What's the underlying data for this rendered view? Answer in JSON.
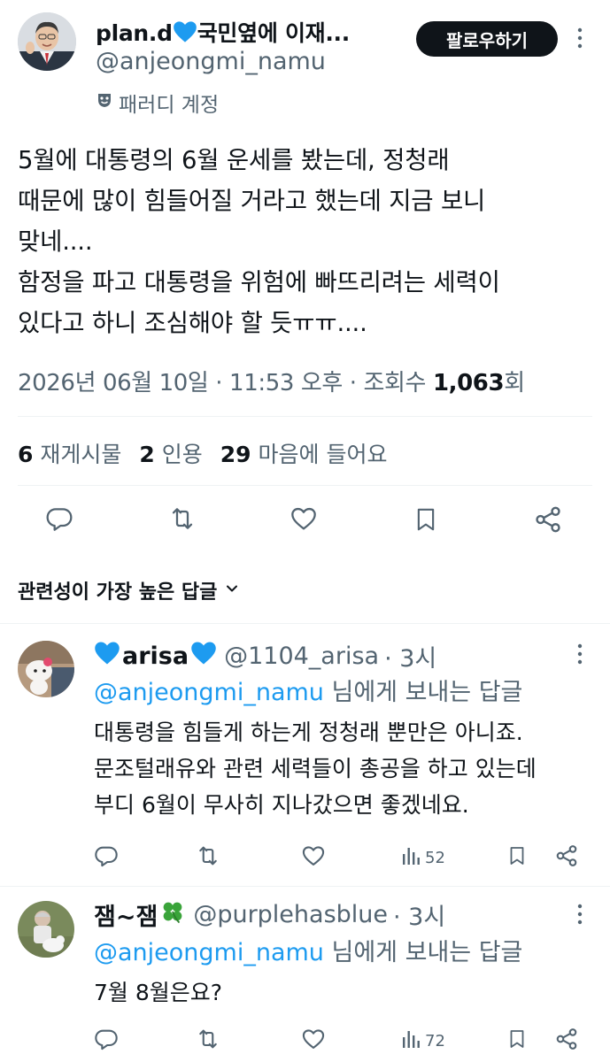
{
  "main_tweet": {
    "display_name": "plan.d",
    "display_name_suffix": "국민옆에 이재...",
    "handle": "@anjeongmi_namu",
    "parody_label": "패러디 계정",
    "follow_label": "팔로우하기",
    "text": "5월에 대통령의 6월 운세를 봤는데, 정청래\n때문에 많이 힘들어질 거라고 했는데 지금 보니\n맞네....\n함정을 파고 대통령을 위험에 빠뜨리려는 세력이\n있다고 하니 조심해야 할 듯ㅠㅠ....",
    "date": "2026년 06월 10일",
    "sep1": " · ",
    "time": "11:53 오후",
    "sep2": " · ",
    "views_label": "조회수 ",
    "views_count": "1,063",
    "views_unit": "회",
    "stats": {
      "retweets_count": "6",
      "retweets_label": "재게시물",
      "quotes_count": "2",
      "quotes_label": "인용",
      "likes_count": "29",
      "likes_label": "마음에 들어요"
    }
  },
  "sort_label": "관련성이 가장 높은 답글",
  "replies": [
    {
      "display_name": "arisa",
      "handle": "@1104_arisa",
      "time": "· 3시",
      "reply_to_mention": "@anjeongmi_namu",
      "reply_to_rest": " 님에게 보내는 답글",
      "text": "대통령을 힘들게 하는게 정청래 뿐만은 아니죠.\n문조털래유와 관련 세력들이 총공을 하고 있는데\n부디 6월이 무사히 지나갔으면 좋겠네요.",
      "views": "52"
    },
    {
      "display_name": "잼~잼",
      "handle": "@purplehasblue",
      "time": "· 3시",
      "reply_to_mention": "@anjeongmi_namu",
      "reply_to_rest": " 님에게 보내는 답글",
      "text": "7월 8월은요?",
      "views": "72"
    }
  ],
  "icons": {
    "verified_heart_color": "#1d9bf0",
    "clover_color": "#3aa43a",
    "secondary_text": "#536471",
    "mention_color": "#1d9bf0"
  }
}
